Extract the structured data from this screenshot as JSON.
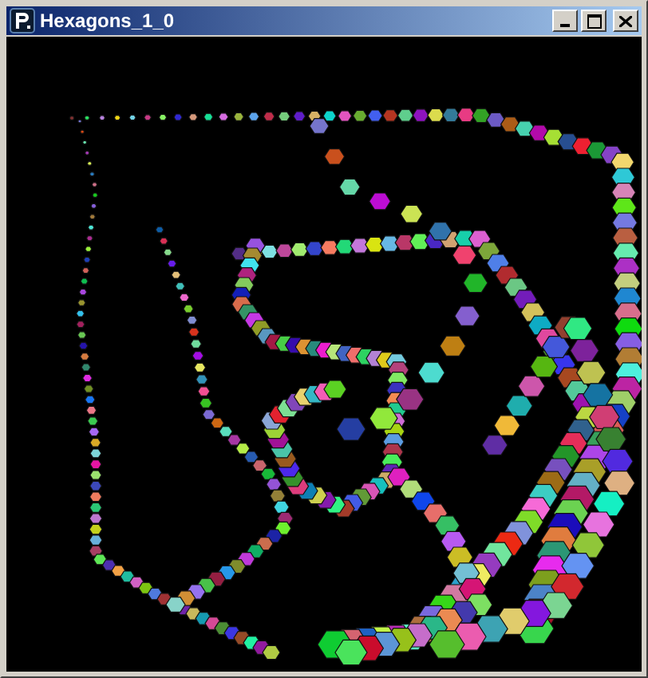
{
  "window": {
    "title": "Hexagons_1_0"
  }
}
